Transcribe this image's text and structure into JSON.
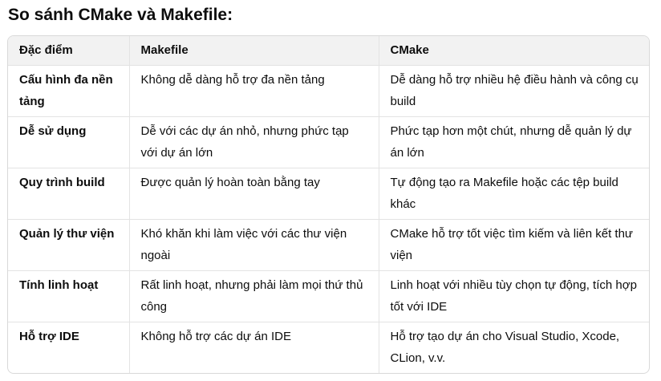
{
  "heading": "So sánh CMake và Makefile:",
  "table": {
    "headers": [
      "Đặc điểm",
      "Makefile",
      "CMake"
    ],
    "rows": [
      {
        "feature": "Cấu hình đa nền tảng",
        "makefile": "Không dễ dàng hỗ trợ đa nền tảng",
        "cmake": "Dễ dàng hỗ trợ nhiều hệ điều hành và công cụ build"
      },
      {
        "feature": "Dễ sử dụng",
        "makefile": "Dễ với các dự án nhỏ, nhưng phức tạp với dự án lớn",
        "cmake": "Phức tạp hơn một chút, nhưng dễ quản lý dự án lớn"
      },
      {
        "feature": "Quy trình build",
        "makefile": "Được quản lý hoàn toàn bằng tay",
        "cmake": "Tự động tạo ra Makefile hoặc các tệp build khác"
      },
      {
        "feature": "Quản lý thư viện",
        "makefile": "Khó khăn khi làm việc với các thư viện ngoài",
        "cmake": "CMake hỗ trợ tốt việc tìm kiếm và liên kết thư viện"
      },
      {
        "feature": "Tính linh hoạt",
        "makefile": "Rất linh hoạt, nhưng phải làm mọi thứ thủ công",
        "cmake": "Linh hoạt với nhiều tùy chọn tự động, tích hợp tốt với IDE"
      },
      {
        "feature": "Hỗ trợ IDE",
        "makefile": "Không hỗ trợ các dự án IDE",
        "cmake": "Hỗ trợ tạo dự án cho Visual Studio, Xcode, CLion, v.v."
      }
    ]
  }
}
